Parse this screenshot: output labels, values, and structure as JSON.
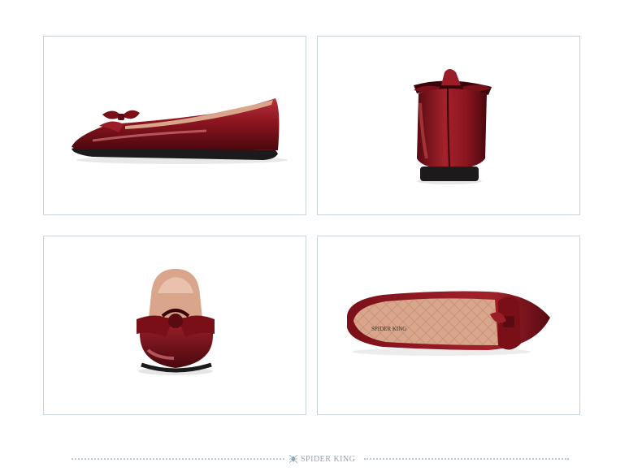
{
  "brand": {
    "name": "SPIDER KING",
    "insole_text": "SPIDER KING"
  },
  "photos": [
    {
      "view": "side-view"
    },
    {
      "view": "back-view"
    },
    {
      "view": "front-view"
    },
    {
      "view": "top-view"
    }
  ],
  "colors": {
    "patent_red": "#8c1520",
    "patent_dark": "#4a070d",
    "lining": "#d9a58b",
    "sole": "#1c1a1a",
    "panel_border": "#c9d3dc",
    "footer_text": "#8fa3b3"
  }
}
